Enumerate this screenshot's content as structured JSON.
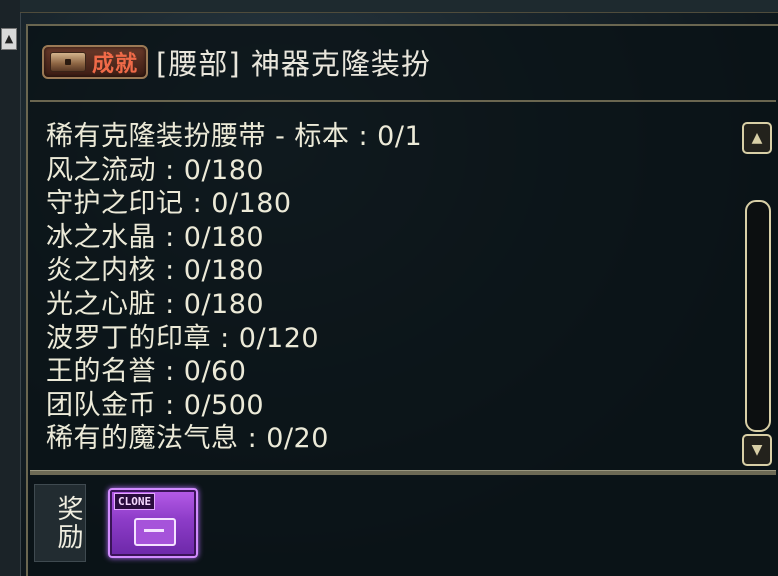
{
  "achievement": {
    "badge_label": "成就",
    "title": "[腰部] 神器克隆装扮",
    "requirements": [
      "稀有克隆装扮腰带 - 标本 : 0/1",
      "风之流动 : 0/180",
      "守护之印记 : 0/180",
      "冰之水晶 : 0/180",
      "炎之内核 : 0/180",
      "光之心脏 : 0/180",
      "波罗丁的印章 : 0/120",
      "王的名誉 : 0/60",
      "团队金币 : 0/500",
      "稀有的魔法气息 : 0/20"
    ],
    "reward_label": "奖励",
    "reward_item_tag": "CLONE"
  },
  "icons": {
    "chest": "chest-icon",
    "scroll_up": "scroll-up-arrow-icon",
    "scroll_down": "scroll-down-arrow-icon",
    "side_arrow": "side-scroll-up-arrow-icon"
  }
}
